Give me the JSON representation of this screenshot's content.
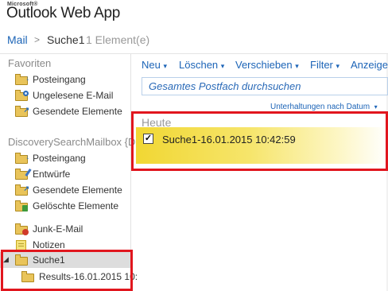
{
  "header": {
    "brand_small": "Microsoft®",
    "app_name": "Outlook Web App"
  },
  "breadcrumb": {
    "root": "Mail",
    "separator": ">",
    "current": "Suche1",
    "count": "1 Element(e)"
  },
  "sidebar": {
    "favorites_title": "Favoriten",
    "favorites": [
      {
        "label": "Posteingang",
        "icon": "inbox-folder-icon"
      },
      {
        "label": "Ungelesene E-Mail",
        "icon": "search-folder-icon"
      },
      {
        "label": "Gesendete Elemente",
        "icon": "sent-folder-icon"
      }
    ],
    "mailbox_title": "DiscoverySearchMailbox {D",
    "mailbox": [
      {
        "label": "Posteingang",
        "icon": "inbox-folder-icon"
      },
      {
        "label": "Entwürfe",
        "icon": "drafts-folder-icon"
      },
      {
        "label": "Gesendete Elemente",
        "icon": "sent-folder-icon"
      },
      {
        "label": "Gelöschte Elemente",
        "icon": "deleted-folder-icon"
      },
      {
        "label": "Junk-E-Mail",
        "icon": "junk-folder-icon"
      },
      {
        "label": "Notizen",
        "icon": "notes-icon"
      },
      {
        "label": "Suche1",
        "icon": "folder-icon",
        "selected": true
      },
      {
        "label": "Results-16.01.2015 10:",
        "icon": "folder-icon"
      }
    ]
  },
  "toolbar": {
    "new": "Neu",
    "delete": "Löschen",
    "move": "Verschieben",
    "filter": "Filter",
    "view": "Anzeige",
    "dropdown_glyph": "▾"
  },
  "search": {
    "placeholder": "Gesamtes Postfach durchsuchen"
  },
  "list": {
    "sort_label": "Unterhaltungen nach Datum",
    "sort_glyph": "▾",
    "group": "Heute",
    "items": [
      {
        "subject": "Suche1-16.01.2015 10:42:59",
        "checked": true
      }
    ]
  },
  "colors": {
    "accent_link": "#1c64b7",
    "highlight_box": "#e1161e",
    "selected_row": "#f1d733"
  }
}
